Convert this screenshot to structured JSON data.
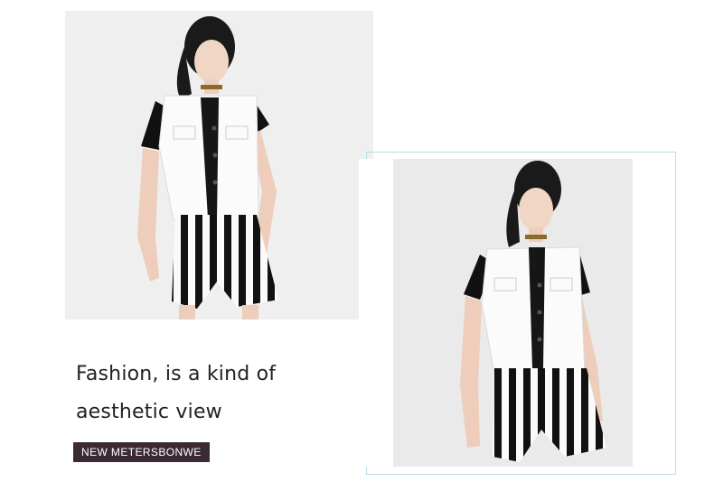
{
  "headline": {
    "line1": "Fashion, is a kind of",
    "line2": "aesthetic view"
  },
  "brand_tag": "NEW METERSBONWE",
  "colors": {
    "frame_border": "#b9dbe8",
    "tag_background": "#3b2a33",
    "photo_background": "#efefef"
  }
}
